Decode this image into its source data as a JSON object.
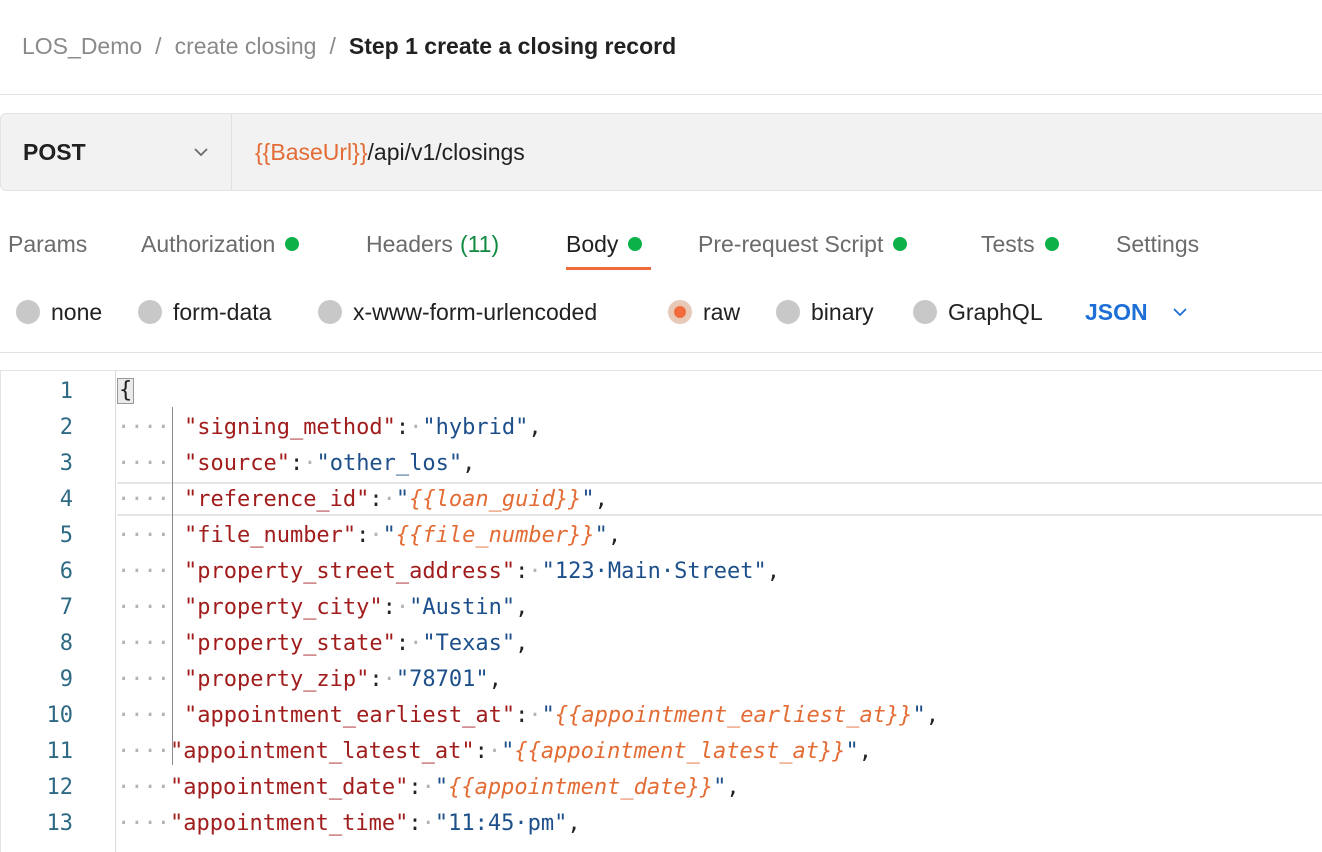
{
  "breadcrumb": {
    "items": [
      "LOS_Demo",
      "create closing"
    ],
    "separator": "/",
    "current": "Step 1 create a closing record"
  },
  "request": {
    "method": "POST",
    "url_variable": "{{BaseUrl}}",
    "url_path": "/api/v1/closings"
  },
  "tabs": {
    "params": "Params",
    "authorization": "Authorization",
    "headers": "Headers",
    "headers_count": "(11)",
    "body": "Body",
    "prerequest": "Pre-request Script",
    "tests": "Tests",
    "settings": "Settings"
  },
  "body_options": {
    "none": "none",
    "form_data": "form-data",
    "urlencoded": "x-www-form-urlencoded",
    "raw": "raw",
    "binary": "binary",
    "graphql": "GraphQL",
    "format": "JSON",
    "selected": "raw"
  },
  "editor": {
    "lines": [
      {
        "n": "1",
        "open": "{"
      },
      {
        "n": "2",
        "dots": "····",
        "key": "\"signing_method\"",
        "value": "\"hybrid\"",
        "value_type": "str"
      },
      {
        "n": "3",
        "dots": "····",
        "key": "\"source\"",
        "value": "\"other_los\"",
        "value_type": "str"
      },
      {
        "n": "4",
        "dots": "····",
        "key": "\"reference_id\"",
        "value": "{{loan_guid}}",
        "value_type": "var"
      },
      {
        "n": "5",
        "dots": "····",
        "key": "\"file_number\"",
        "value": "{{file_number}}",
        "value_type": "var"
      },
      {
        "n": "6",
        "dots": "····",
        "key": "\"property_street_address\"",
        "value": "\"123·Main·Street\"",
        "value_type": "str"
      },
      {
        "n": "7",
        "dots": "····",
        "key": "\"property_city\"",
        "value": "\"Austin\"",
        "value_type": "str"
      },
      {
        "n": "8",
        "dots": "····",
        "key": "\"property_state\"",
        "value": "\"Texas\"",
        "value_type": "str"
      },
      {
        "n": "9",
        "dots": "····",
        "key": "\"property_zip\"",
        "value": "\"78701\"",
        "value_type": "str"
      },
      {
        "n": "10",
        "dots": "····",
        "key": "\"appointment_earliest_at\"",
        "value": "{{appointment_earliest_at}}",
        "value_type": "var"
      },
      {
        "n": "11",
        "dots": "····",
        "key": "\"appointment_latest_at\"",
        "value": "{{appointment_latest_at}}",
        "value_type": "var"
      },
      {
        "n": "12",
        "dots": "····",
        "key": "\"appointment_date\"",
        "value": "{{appointment_date}}",
        "value_type": "var"
      },
      {
        "n": "13",
        "dots": "····",
        "key": "\"appointment_time\"",
        "value": "\"11:45·pm\"",
        "value_type": "str"
      }
    ]
  },
  "colors": {
    "accent_orange": "#f26b3a",
    "variable_orange": "#e36c35",
    "status_green": "#0cb14a",
    "link_blue": "#1d6fd6",
    "json_key": "#a11d1d",
    "json_string": "#1d4f8a"
  }
}
